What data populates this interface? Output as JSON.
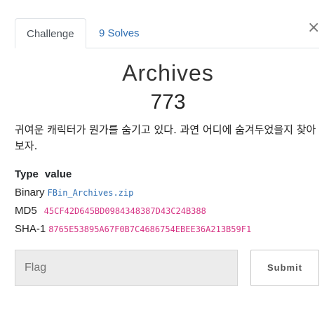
{
  "tabs": {
    "challenge": "Challenge",
    "solves": "9 Solves"
  },
  "close_glyph": "×",
  "challenge": {
    "name": "Archives",
    "points": "773",
    "description": "귀여운 캐릭터가 뭔가를 숨기고 있다. 과연 어디에 숨겨두었을지 찾아보자."
  },
  "files": {
    "header_type": "Type",
    "header_value": "value",
    "rows": [
      {
        "type": "Binary",
        "value": "FBin_Archives.zip"
      },
      {
        "type": "MD5",
        "value": "45CF42D645BD0984348387D43C24B388"
      },
      {
        "type": "SHA-1",
        "value": "8765E53895A67F0B7C4686754EBEE36A213B59F1"
      }
    ]
  },
  "flag_input": {
    "placeholder": "Flag",
    "value": ""
  },
  "submit_label": "Submit",
  "colors": {
    "link": "#2f6fb3",
    "hash": "#d63384"
  }
}
